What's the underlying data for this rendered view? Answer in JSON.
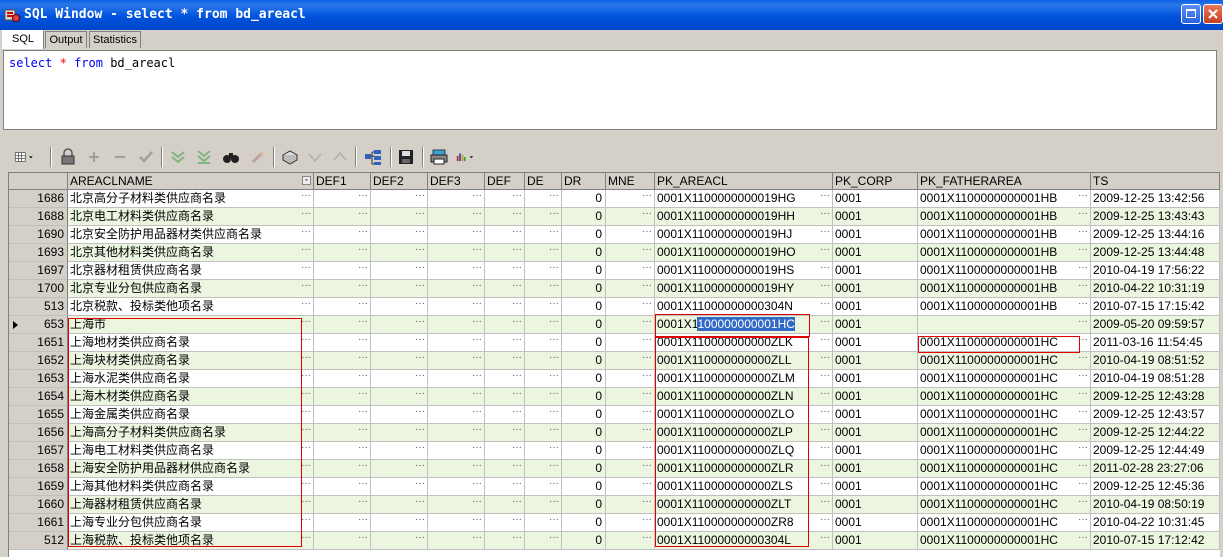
{
  "window": {
    "title": "SQL Window - select * from bd_areacl"
  },
  "tabs": [
    {
      "label": "SQL"
    },
    {
      "label": "Output"
    },
    {
      "label": "Statistics"
    }
  ],
  "editor": {
    "kw1": "select",
    "star": "*",
    "kw2": "from",
    "table": "bd_areacl"
  },
  "toolbar_icons": [
    "grid-options-icon",
    "lock-icon",
    "add-record-icon",
    "delete-record-icon",
    "post-record-icon",
    "next-rows-icon",
    "last-row-icon",
    "find-icon",
    "clear-icon",
    "query-by-example-icon",
    "filter-icon",
    "sort-icon",
    "export-icon",
    "save-icon",
    "print-icon",
    "chart-icon"
  ],
  "columns": [
    {
      "label": ""
    },
    {
      "label": "AREACLNAME"
    },
    {
      "label": "DEF1"
    },
    {
      "label": "DEF2"
    },
    {
      "label": "DEF3"
    },
    {
      "label": "DEF"
    },
    {
      "label": "DE"
    },
    {
      "label": "DR"
    },
    {
      "label": "MNE"
    },
    {
      "label": "PK_AREACL"
    },
    {
      "label": "PK_CORP"
    },
    {
      "label": "PK_FATHERAREA"
    },
    {
      "label": "TS"
    }
  ],
  "rows": [
    {
      "n": "1686",
      "name": "北京高分子材料类供应商名录",
      "dr": "0",
      "pk": "0001X1100000000019HG",
      "corp": "0001",
      "father": "0001X1100000000001HB",
      "ts": "2009-12-25 13:42:56"
    },
    {
      "n": "1688",
      "name": "北京电工材料类供应商名录",
      "dr": "0",
      "pk": "0001X1100000000019HH",
      "corp": "0001",
      "father": "0001X1100000000001HB",
      "ts": "2009-12-25 13:43:43"
    },
    {
      "n": "1690",
      "name": "北京安全防护用品器材类供应商名录",
      "dr": "0",
      "pk": "0001X1100000000019HJ",
      "corp": "0001",
      "father": "0001X1100000000001HB",
      "ts": "2009-12-25 13:44:16"
    },
    {
      "n": "1693",
      "name": "北京其他材料类供应商名录",
      "dr": "0",
      "pk": "0001X1100000000019HO",
      "corp": "0001",
      "father": "0001X1100000000001HB",
      "ts": "2009-12-25 13:44:48"
    },
    {
      "n": "1697",
      "name": "北京器材租赁供应商名录",
      "dr": "0",
      "pk": "0001X1100000000019HS",
      "corp": "0001",
      "father": "0001X1100000000001HB",
      "ts": "2010-04-19 17:56:22"
    },
    {
      "n": "1700",
      "name": "北京专业分包供应商名录",
      "dr": "0",
      "pk": "0001X1100000000019HY",
      "corp": "0001",
      "father": "0001X1100000000001HB",
      "ts": "2010-04-22 10:31:19"
    },
    {
      "n": "513",
      "name": "北京税款、投标类他项名录",
      "dr": "0",
      "pk": "0001X11000000000304N",
      "corp": "0001",
      "father": "0001X1100000000001HB",
      "ts": "2010-07-15 17:15:42"
    },
    {
      "n": "653",
      "name": "上海市",
      "dr": "0",
      "pk_a": "0001X1",
      "pk_b": "100000000001HC",
      "corp": "0001",
      "father": "",
      "ts": "2009-05-20 09:59:57"
    },
    {
      "n": "1651",
      "name": "上海地材类供应商名录",
      "dr": "0",
      "pk": "0001X110000000000ZLK",
      "corp": "0001",
      "father": "0001X1100000000001HC",
      "ts": "2011-03-16 11:54:45"
    },
    {
      "n": "1652",
      "name": "上海块材类供应商名录",
      "dr": "0",
      "pk": "0001X110000000000ZLL",
      "corp": "0001",
      "father": "0001X1100000000001HC",
      "ts": "2010-04-19 08:51:52"
    },
    {
      "n": "1653",
      "name": "上海水泥类供应商名录",
      "dr": "0",
      "pk": "0001X110000000000ZLM",
      "corp": "0001",
      "father": "0001X1100000000001HC",
      "ts": "2010-04-19 08:51:28"
    },
    {
      "n": "1654",
      "name": "上海木材类供应商名录",
      "dr": "0",
      "pk": "0001X110000000000ZLN",
      "corp": "0001",
      "father": "0001X1100000000001HC",
      "ts": "2009-12-25 12:43:28"
    },
    {
      "n": "1655",
      "name": "上海金属类供应商名录",
      "dr": "0",
      "pk": "0001X110000000000ZLO",
      "corp": "0001",
      "father": "0001X1100000000001HC",
      "ts": "2009-12-25 12:43:57"
    },
    {
      "n": "1656",
      "name": "上海高分子材料类供应商名录",
      "dr": "0",
      "pk": "0001X110000000000ZLP",
      "corp": "0001",
      "father": "0001X1100000000001HC",
      "ts": "2009-12-25 12:44:22"
    },
    {
      "n": "1657",
      "name": "上海电工材料类供应商名录",
      "dr": "0",
      "pk": "0001X110000000000ZLQ",
      "corp": "0001",
      "father": "0001X1100000000001HC",
      "ts": "2009-12-25 12:44:49"
    },
    {
      "n": "1658",
      "name": "上海安全防护用品器材供应商名录",
      "dr": "0",
      "pk": "0001X110000000000ZLR",
      "corp": "0001",
      "father": "0001X1100000000001HC",
      "ts": "2011-02-28 23:27:06"
    },
    {
      "n": "1659",
      "name": "上海其他材料类供应商名录",
      "dr": "0",
      "pk": "0001X110000000000ZLS",
      "corp": "0001",
      "father": "0001X1100000000001HC",
      "ts": "2009-12-25 12:45:36"
    },
    {
      "n": "1660",
      "name": "上海器材租赁供应商名录",
      "dr": "0",
      "pk": "0001X110000000000ZLT",
      "corp": "0001",
      "father": "0001X1100000000001HC",
      "ts": "2010-04-19 08:50:19"
    },
    {
      "n": "1661",
      "name": "上海专业分包供应商名录",
      "dr": "0",
      "pk": "0001X110000000000ZR8",
      "corp": "0001",
      "father": "0001X1100000000001HC",
      "ts": "2010-04-22 10:31:45"
    },
    {
      "n": "512",
      "name": "上海税款、投标类他项名录",
      "dr": "0",
      "pk": "0001X11000000000304L",
      "corp": "0001",
      "father": "0001X1100000000001HC",
      "ts": "2010-07-15 17:12:42"
    }
  ]
}
